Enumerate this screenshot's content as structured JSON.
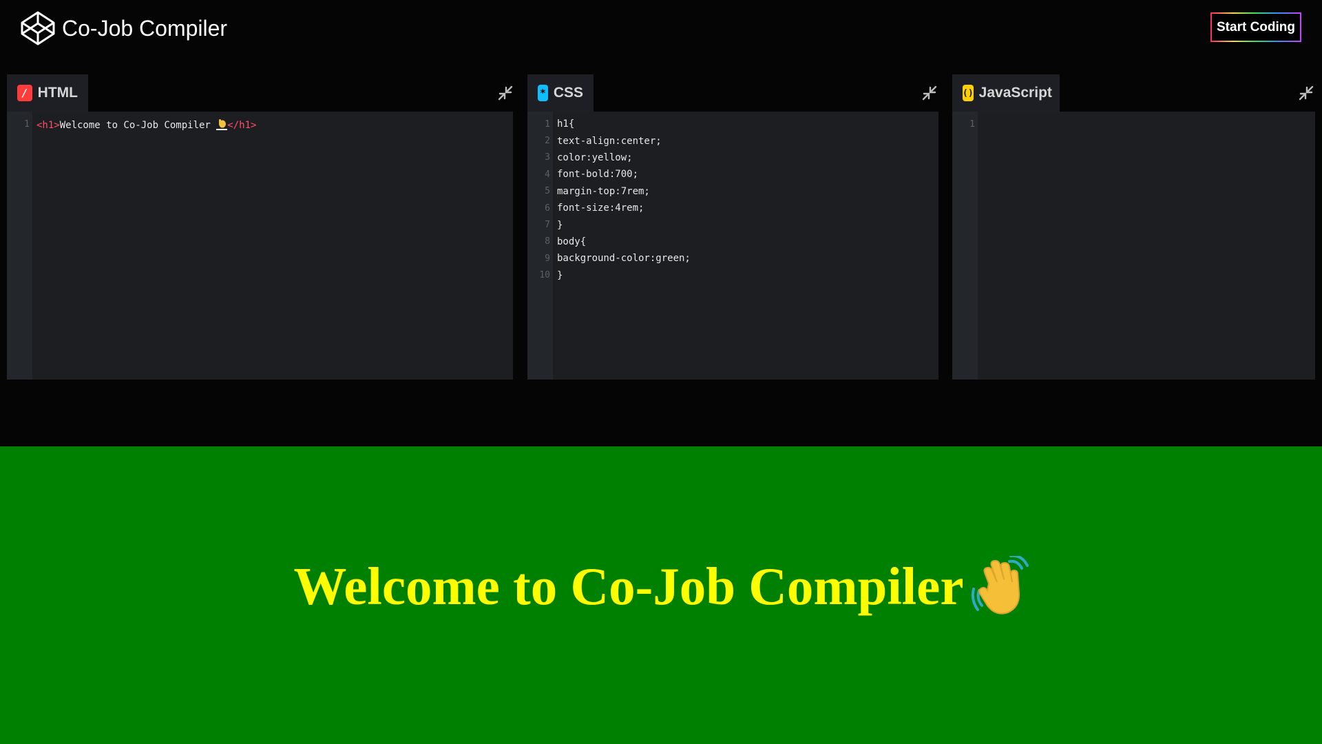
{
  "header": {
    "title": "Co-Job Compiler",
    "start_button": "Start Coding"
  },
  "editors": [
    {
      "id": "html",
      "label": "HTML",
      "icon": "html-icon",
      "lines": [
        "<h1>Welcome to Co-Job Compiler 👋</h1>"
      ],
      "line_numbers": [
        "1"
      ]
    },
    {
      "id": "css",
      "label": "CSS",
      "icon": "css-icon",
      "lines": [
        "h1{",
        "text-align:center;",
        "color:yellow;",
        "font-bold:700;",
        "margin-top:7rem;",
        "font-size:4rem;",
        "}",
        "body{",
        "background-color:green;",
        "}"
      ],
      "line_numbers": [
        "1",
        "2",
        "3",
        "4",
        "5",
        "6",
        "7",
        "8",
        "9",
        "10"
      ]
    },
    {
      "id": "javascript",
      "label": "JavaScript",
      "icon": "js-icon",
      "lines": [
        ""
      ],
      "line_numbers": [
        "1"
      ]
    }
  ],
  "preview": {
    "heading": "Welcome to Co-Job Compiler",
    "background": "#008000",
    "text_color": "#ffff00"
  },
  "html_code": {
    "open_tag": "<h1>",
    "text": "Welcome to Co-Job Compiler ",
    "close_tag": "</h1>"
  }
}
